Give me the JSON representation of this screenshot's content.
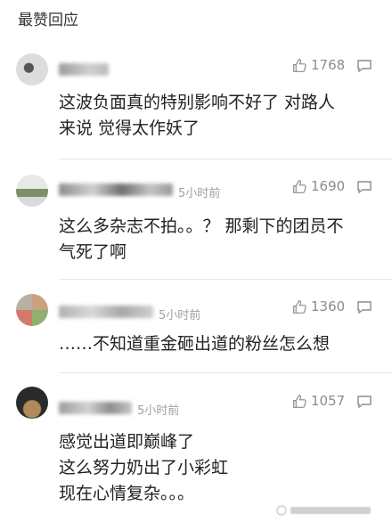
{
  "section_title": "最赞回应",
  "comments": [
    {
      "time": "",
      "likes": "1768",
      "text": "这波负面真的特别影响不好了 对路人\n来说 觉得太作妖了"
    },
    {
      "time": "5小时前",
      "likes": "1690",
      "text": "这么多杂志不拍。。？ 那剩下的团员不\n气死了啊"
    },
    {
      "time": "5小时前",
      "likes": "1360",
      "text": "……不知道重金砸出道的粉丝怎么想"
    },
    {
      "time": "5小时前",
      "likes": "1057",
      "text": "感觉出道即巅峰了\n这么努力奶出了小彩虹\n现在心情复杂。。。"
    }
  ],
  "colors": {
    "text": "#222222",
    "muted": "#a0a0a0",
    "icon": "#8c8c8c",
    "divider": "#e6e6e6"
  }
}
